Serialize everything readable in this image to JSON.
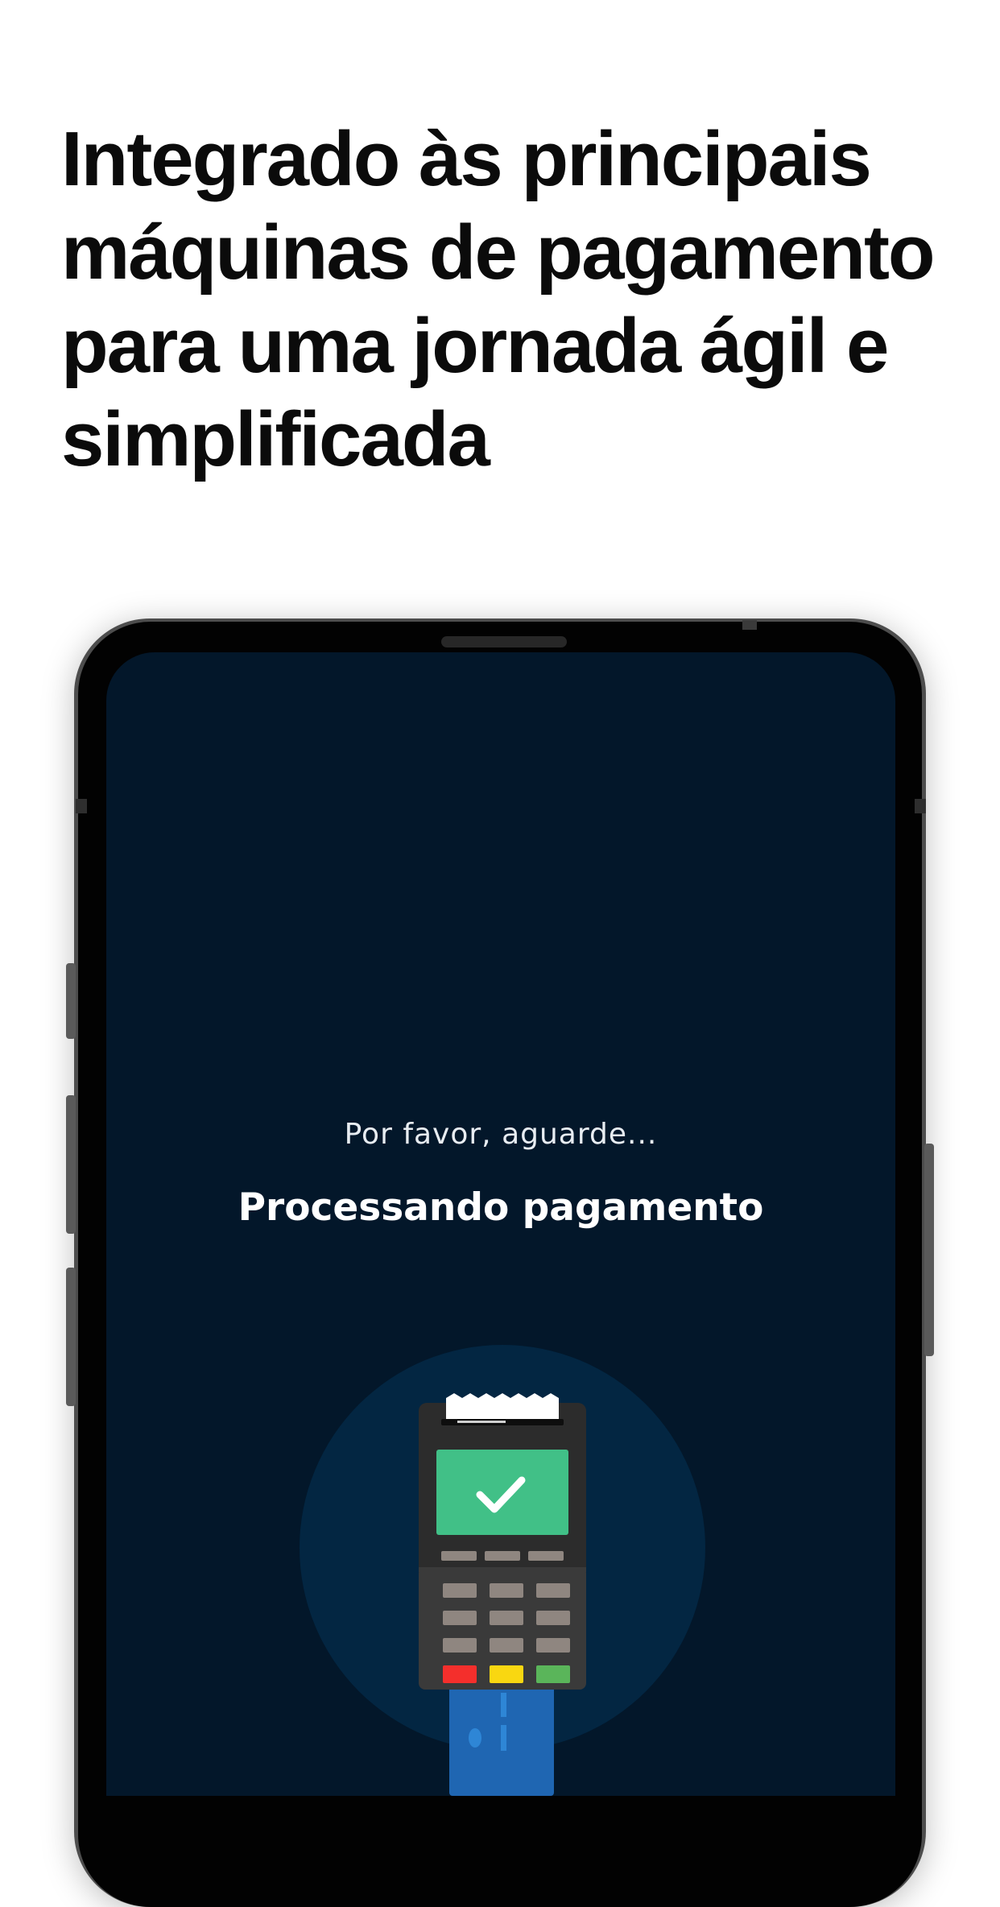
{
  "headline": {
    "lines": [
      "Integrado às principais",
      "máquinas de pagamento",
      "para uma jornada ágil e",
      "simplificada"
    ]
  },
  "screen": {
    "wait_message": "Por favor, aguarde...",
    "status_message": "Processando pagamento",
    "illustration": {
      "icon": "payment-terminal-icon",
      "status_icon": "checkmark-icon",
      "colors": {
        "screen_background": "#03172a",
        "circle": "#032642",
        "terminal_body": "#2c2c2c",
        "display_success": "#41c087",
        "key_red": "#f42f2c",
        "key_yellow": "#f9d711",
        "key_green": "#5ab55a",
        "card": "#1f66b2"
      }
    }
  },
  "colors": {
    "page_background": "#ffffff",
    "headline_text": "#0b0b0b",
    "device_frame": "#020202"
  }
}
